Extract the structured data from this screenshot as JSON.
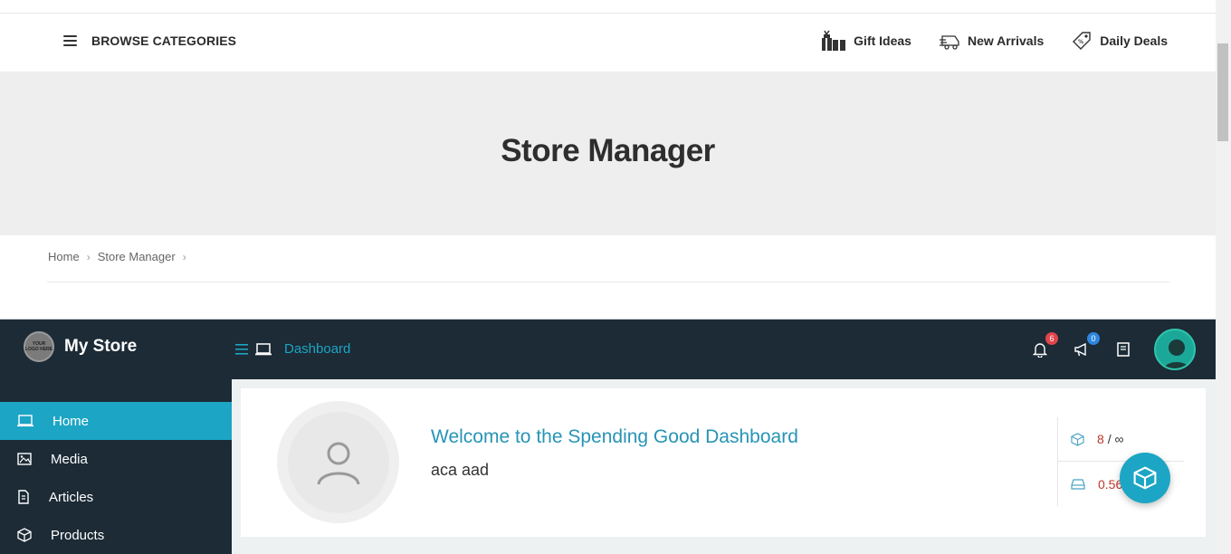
{
  "catbar": {
    "browse_label": "BROWSE CATEGORIES",
    "links": [
      {
        "label": "Gift Ideas",
        "icon": "gift-icon"
      },
      {
        "label": "New Arrivals",
        "icon": "delivery-icon"
      },
      {
        "label": "Daily Deals",
        "icon": "tag-icon"
      }
    ]
  },
  "hero": {
    "title": "Store Manager"
  },
  "breadcrumb": {
    "items": [
      "Home",
      "Store Manager"
    ],
    "separator": ">"
  },
  "dashboard": {
    "brand_logo_text": "YOUR LOGO HERE",
    "brand_name": "My Store",
    "header_label": "Dashboard",
    "notifications_count": "6",
    "announcements_count": "0",
    "sidebar": [
      {
        "label": "Home",
        "icon": "home-screen-icon",
        "active": true
      },
      {
        "label": "Media",
        "icon": "image-icon",
        "active": false
      },
      {
        "label": "Articles",
        "icon": "document-icon",
        "active": false
      },
      {
        "label": "Products",
        "icon": "cube-icon",
        "active": false
      }
    ],
    "welcome_title": "Welcome to the Spending Good Dashboard",
    "username": "aca aad",
    "stats": {
      "products_value": "8",
      "products_limit": "∞",
      "products_sep": "/",
      "storage_value": "0.56"
    }
  },
  "colors": {
    "accent": "#1ca5c4",
    "dark": "#1c2b36",
    "hero_bg": "#eeeeee",
    "stat_red": "#c0392b"
  }
}
